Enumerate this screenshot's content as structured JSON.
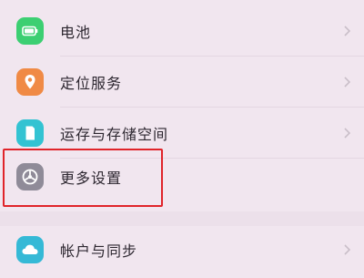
{
  "settings": {
    "items": [
      {
        "label": "电池",
        "icon": "battery-icon",
        "color": "#3ccf72"
      },
      {
        "label": "定位服务",
        "icon": "location-pin-icon",
        "color": "#f08a45"
      },
      {
        "label": "运存与存储空间",
        "icon": "storage-icon",
        "color": "#33c3d2"
      },
      {
        "label": "更多设置",
        "icon": "more-settings-icon",
        "color": "#8f8b98"
      },
      {
        "label": "帐户与同步",
        "icon": "cloud-sync-icon",
        "color": "#35b9d6"
      }
    ]
  },
  "annotation": {
    "highlight_color": "#e0242a",
    "highlighted_item": "更多设置"
  }
}
